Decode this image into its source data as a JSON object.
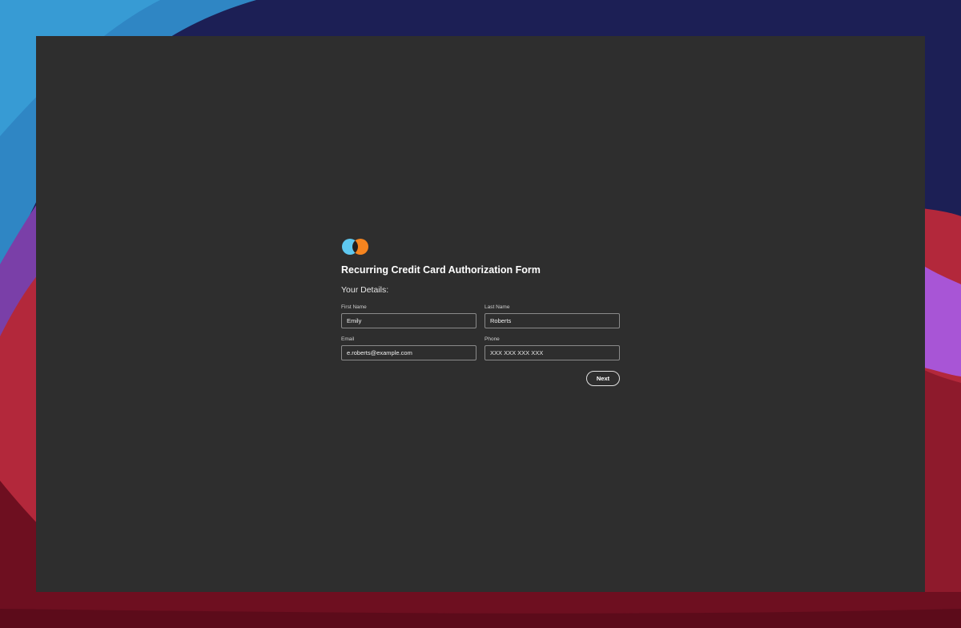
{
  "wallpaper": {
    "colors": {
      "base": "#1c1f55",
      "blue_wave": "#2f86c4",
      "red_wave": "#b3283b",
      "purple_wave": "#a855d6",
      "deep_red": "#5c0b1a"
    }
  },
  "form": {
    "logo_icon": "overlapping-circles-logo-icon",
    "logo_colors": {
      "left": "#5ec8f0",
      "right": "#f5841f",
      "overlap": "#1f1f1f"
    },
    "title": "Recurring Credit Card Authorization Form",
    "section_heading": "Your Details:",
    "fields": {
      "first_name": {
        "label": "First Name",
        "value": "Emily"
      },
      "last_name": {
        "label": "Last Name",
        "value": "Roberts"
      },
      "email": {
        "label": "Email",
        "value": "e.roberts@example.com"
      },
      "phone": {
        "label": "Phone",
        "value": "",
        "placeholder": "XXX XXX XXX XXX"
      }
    },
    "next_label": "Next"
  },
  "colors": {
    "window_background": "#2e2e2e",
    "input_border": "#8a8a8a",
    "text": "#ffffff"
  }
}
